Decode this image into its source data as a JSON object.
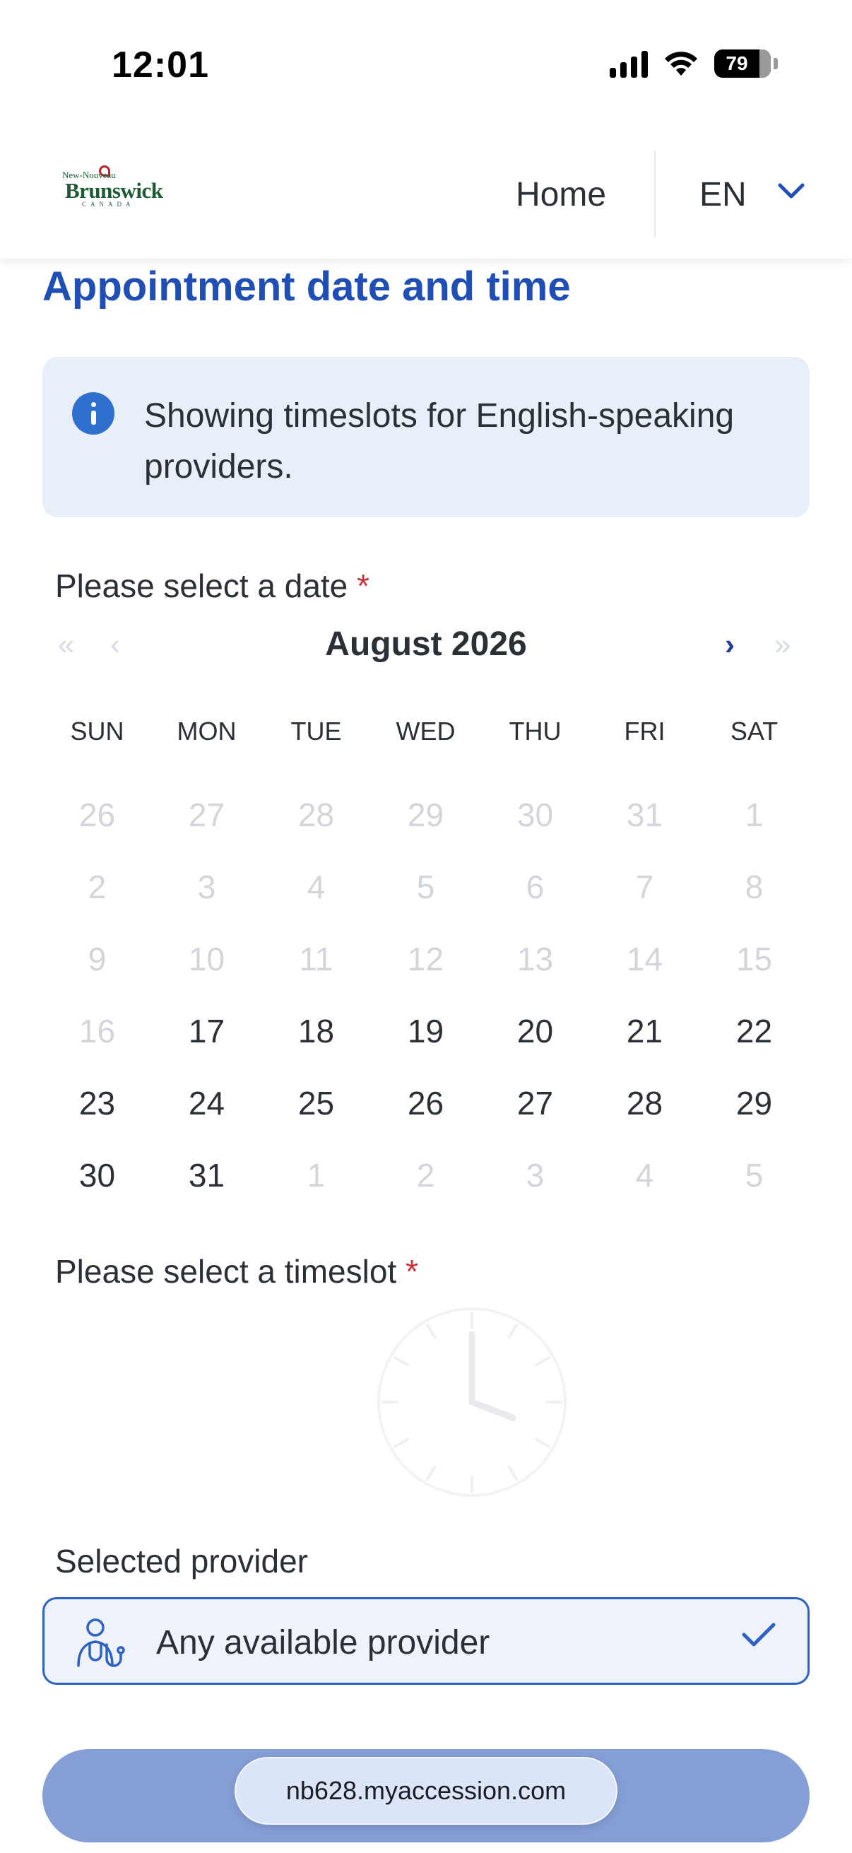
{
  "status_bar": {
    "time": "12:01",
    "battery": "79"
  },
  "header": {
    "logo": {
      "top_line": "New-Nouveau",
      "brand": "Brunswick",
      "country": "CANADA"
    },
    "home_label": "Home",
    "language": "EN"
  },
  "page": {
    "title": "Appointment date and time",
    "info_text": "Showing timeslots for English-speaking providers."
  },
  "date_field": {
    "label": "Please select a date",
    "required_mark": "*"
  },
  "calendar": {
    "prev_year": "«",
    "prev_month": "‹",
    "month_label": "August 2026",
    "next_month": "›",
    "next_year": "»",
    "weekdays": [
      "SUN",
      "MON",
      "TUE",
      "WED",
      "THU",
      "FRI",
      "SAT"
    ],
    "weeks": [
      [
        {
          "d": "26",
          "m": true
        },
        {
          "d": "27",
          "m": true
        },
        {
          "d": "28",
          "m": true
        },
        {
          "d": "29",
          "m": true
        },
        {
          "d": "30",
          "m": true
        },
        {
          "d": "31",
          "m": true
        },
        {
          "d": "1",
          "m": true
        }
      ],
      [
        {
          "d": "2",
          "m": true
        },
        {
          "d": "3",
          "m": true
        },
        {
          "d": "4",
          "m": true
        },
        {
          "d": "5",
          "m": true
        },
        {
          "d": "6",
          "m": true
        },
        {
          "d": "7",
          "m": true
        },
        {
          "d": "8",
          "m": true
        }
      ],
      [
        {
          "d": "9",
          "m": true
        },
        {
          "d": "10",
          "m": true
        },
        {
          "d": "11",
          "m": true
        },
        {
          "d": "12",
          "m": true
        },
        {
          "d": "13",
          "m": true
        },
        {
          "d": "14",
          "m": true
        },
        {
          "d": "15",
          "m": true
        }
      ],
      [
        {
          "d": "16",
          "m": true
        },
        {
          "d": "17",
          "m": false
        },
        {
          "d": "18",
          "m": false
        },
        {
          "d": "19",
          "m": false
        },
        {
          "d": "20",
          "m": false
        },
        {
          "d": "21",
          "m": false
        },
        {
          "d": "22",
          "m": false
        }
      ],
      [
        {
          "d": "23",
          "m": false
        },
        {
          "d": "24",
          "m": false
        },
        {
          "d": "25",
          "m": false
        },
        {
          "d": "26",
          "m": false
        },
        {
          "d": "27",
          "m": false
        },
        {
          "d": "28",
          "m": false
        },
        {
          "d": "29",
          "m": false
        }
      ],
      [
        {
          "d": "30",
          "m": false
        },
        {
          "d": "31",
          "m": false
        },
        {
          "d": "1",
          "m": true
        },
        {
          "d": "2",
          "m": true
        },
        {
          "d": "3",
          "m": true
        },
        {
          "d": "4",
          "m": true
        },
        {
          "d": "5",
          "m": true
        }
      ]
    ]
  },
  "timeslot_field": {
    "label": "Please select a timeslot",
    "required_mark": "*"
  },
  "provider": {
    "label": "Selected provider",
    "value": "Any available provider"
  },
  "browser": {
    "url": "nb628.myaccession.com"
  },
  "colors": {
    "accent": "#1f4fb5",
    "info_bg": "#e8eff9",
    "required": "#c8323a",
    "button": "#859fd6"
  }
}
